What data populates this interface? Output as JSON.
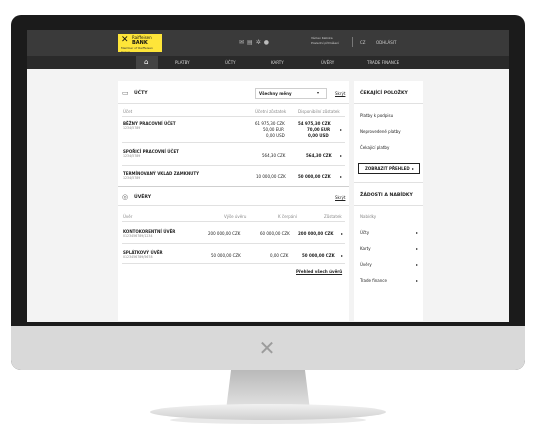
{
  "topbar": {
    "logo_line1": "Raiffeisen",
    "logo_line2": "BANK",
    "logo_line3": "Member of Raiffeisen Group",
    "logo_mark": "✕",
    "user_line1": "Václav Kalinka",
    "user_line2": "Poslední přihlášení",
    "lang": "CZ",
    "logout": "ODHLÁSIT"
  },
  "nav": {
    "items": [
      "PLATBY",
      "ÚČTY",
      "KARTY",
      "ÚVĚRY",
      "TRADE FINANCE"
    ]
  },
  "accounts": {
    "title": "ÚČTY",
    "filter": "Všechny měny",
    "more": "Skrýt",
    "col_account": "Účet",
    "col_balance": "Účetní zůstatek",
    "col_available": "Disponibilní zůstatek",
    "rows": [
      {
        "name": "BĚŽNÝ PRACOVNÍ ÚČET",
        "number": "1234/5789",
        "balance": [
          "61 975,30 CZK",
          "50,00 EUR",
          "0,00 USD"
        ],
        "available": [
          "54 975,30 CZK",
          "70,00 EUR",
          "0,00 USD"
        ]
      },
      {
        "name": "SPOŘICÍ PRACOVNÍ ÚČET",
        "number": "1234/5789",
        "balance": [
          "564,30 CZK"
        ],
        "available": [
          "564,30 CZK"
        ]
      },
      {
        "name": "TERMÍNOVANÝ VKLAD ZAMKNUTÝ",
        "number": "1234/5789",
        "balance": [
          "10 000,00 CZK"
        ],
        "available": [
          "50 000,00 CZK"
        ]
      }
    ]
  },
  "loans": {
    "title": "ÚVĚRY",
    "more": "Skrýt",
    "col_loan": "Úvěr",
    "col_limit": "Výše úvěru",
    "col_repay": "K čerpání",
    "col_total": "Zůstatek",
    "rows": [
      {
        "name": "KONTOKORENTNÍ ÚVĚR",
        "number": "0123456789/1234",
        "limit": "200 000,00 CZK",
        "repay": "60 000,00 CZK",
        "total": "200 000,00 CZK"
      },
      {
        "name": "SPLÁTKOVÝ ÚVĚR",
        "number": "0123456789/5678",
        "limit": "50 000,00 CZK",
        "repay": "0,00 CZK",
        "total": "50 000,00 CZK"
      }
    ],
    "footer": "Přehled všech úvěrů"
  },
  "pending": {
    "title": "ČEKAJÍCÍ POLOŽKY",
    "items": [
      "Platby k podpisu",
      "Neprovedené platby",
      "Čekající platby"
    ],
    "button": "ZOBRAZIT PŘEHLED"
  },
  "requests": {
    "title": "ŽÁDOSTI A NABÍDKY",
    "items": [
      "Nabídky",
      "Účty",
      "Karty",
      "Úvěry",
      "Trade finance"
    ]
  }
}
